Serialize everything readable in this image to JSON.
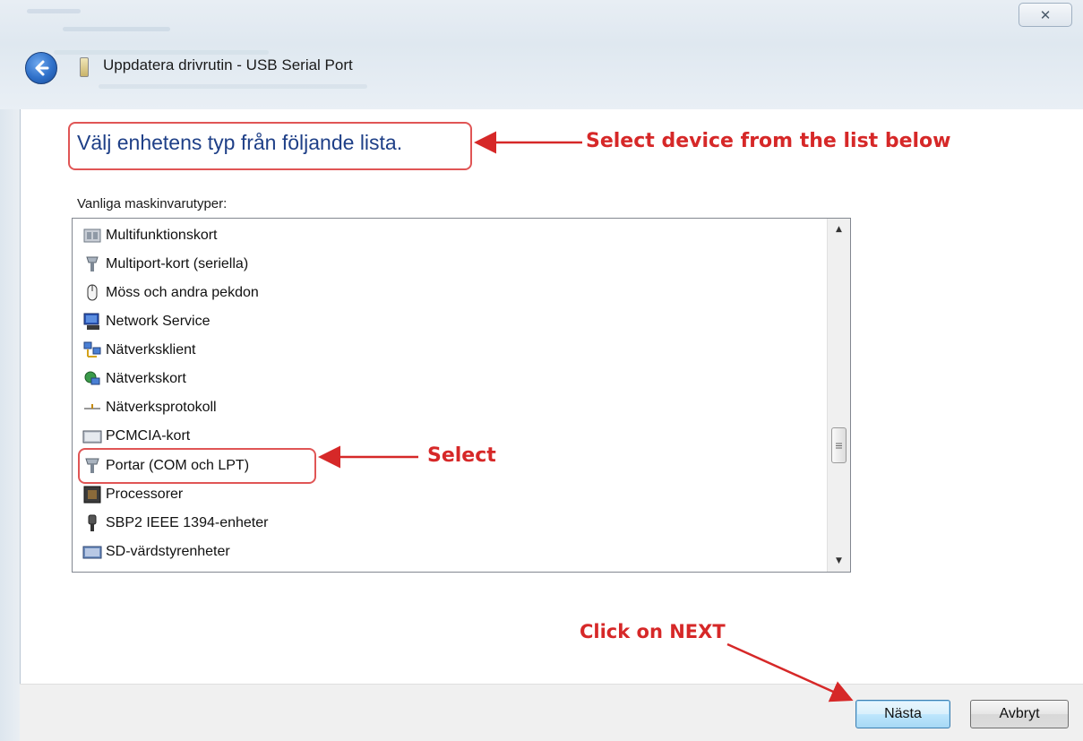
{
  "window": {
    "title": "Uppdatera drivrutin - USB Serial Port",
    "close_glyph": "✕"
  },
  "page": {
    "heading": "Välj enhetens typ från följande lista.",
    "list_label": "Vanliga maskinvarutyper:"
  },
  "list": {
    "items": [
      {
        "label": "Multifunktionskort",
        "icon": "multifunction-card-icon"
      },
      {
        "label": "Multiport-kort (seriella)",
        "icon": "multiport-card-icon"
      },
      {
        "label": "Möss och andra pekdon",
        "icon": "mouse-icon"
      },
      {
        "label": "Network Service",
        "icon": "network-service-icon"
      },
      {
        "label": "Nätverksklient",
        "icon": "network-client-icon"
      },
      {
        "label": "Nätverkskort",
        "icon": "network-card-icon"
      },
      {
        "label": "Nätverksprotokoll",
        "icon": "network-protocol-icon"
      },
      {
        "label": "PCMCIA-kort",
        "icon": "pcmcia-card-icon"
      },
      {
        "label": "Portar (COM och LPT)",
        "icon": "port-icon"
      },
      {
        "label": "Processorer",
        "icon": "processor-icon"
      },
      {
        "label": "SBP2 IEEE 1394-enheter",
        "icon": "ieee1394-icon"
      },
      {
        "label": "SD-värdstyrenheter",
        "icon": "sd-host-icon"
      }
    ]
  },
  "annotations": {
    "select_device": "Select device from the list below",
    "select": "Select",
    "click_next": "Click on NEXT",
    "color": "#d62828"
  },
  "buttons": {
    "next": "Nästa",
    "cancel": "Avbryt"
  }
}
